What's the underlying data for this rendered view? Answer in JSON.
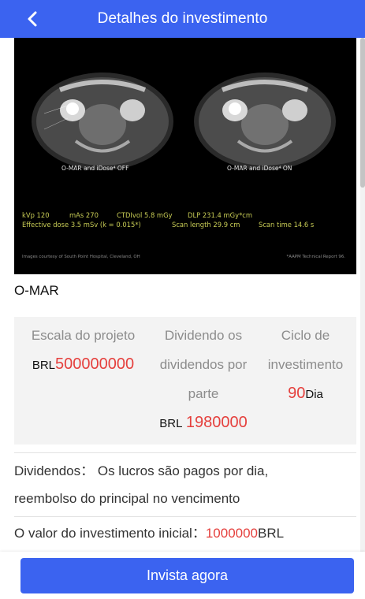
{
  "header": {
    "title": "Detalhes do investimento",
    "back_icon": "chevron-left-icon"
  },
  "hero_image": {
    "caption_left": "O-MAR and iDose⁴ OFF",
    "caption_right": "O-MAR and iDose⁴ ON",
    "stats_line1": [
      "kVp 120",
      "mAs 270",
      "CTDIvol 5.8 mGy",
      "DLP 231.4 mGy*cm"
    ],
    "stats_line2": [
      "Effective dose 3.5 mSv (k = 0.015*)",
      "Scan length 29.9 cm",
      "Scan time 14.6 s"
    ],
    "credit": "Images courtesy of South Point Hospital, Cleveland, OH",
    "reference": "*AAPM Technical Report 96."
  },
  "product": {
    "name": "O-MAR"
  },
  "stats": {
    "scale": {
      "label": "Escala do projeto",
      "currency": "BRL",
      "value": "500000000"
    },
    "dividend": {
      "label_line1": "Dividendo os",
      "label_line2": "dividendos por",
      "label_line3": "parte",
      "currency": "BRL",
      "value": "1980000"
    },
    "cycle": {
      "label_line1": "Ciclo de",
      "label_line2": "investimento",
      "value": "90",
      "unit": "Dia"
    }
  },
  "dividends": {
    "label": "Dividendos：",
    "text_line1": "Os lucros são pagos por dia,",
    "text_line2": "reembolso do principal no vencimento"
  },
  "initial": {
    "label": "O valor do investimento inicial：",
    "value": "1000000",
    "currency": "BRL"
  },
  "footer": {
    "button_label": "Invista agora"
  },
  "colors": {
    "brand": "#3b63f0",
    "accent_red": "#e5403d",
    "panel_bg": "#f3f3f3"
  }
}
